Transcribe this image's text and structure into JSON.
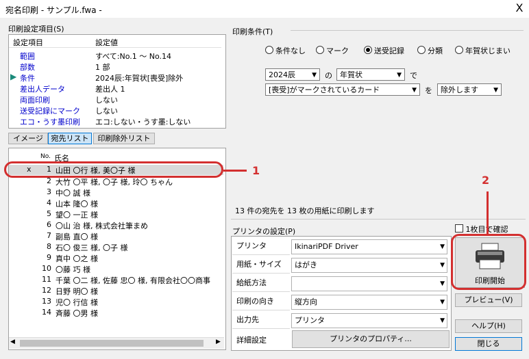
{
  "window": {
    "title": "宛名印刷 - サンプル.fwa -",
    "close": "X"
  },
  "left": {
    "section_label": "印刷設定項目(S)",
    "col_item": "設定項目",
    "col_value": "設定値",
    "rows": [
      {
        "item": "範囲",
        "value": "すべて:No.1 ～ No.14"
      },
      {
        "item": "部数",
        "value": "1 部"
      },
      {
        "item": "条件",
        "value": "2024辰:年賀状[喪受]除外"
      },
      {
        "item": "差出人データ",
        "value": "差出人 1"
      },
      {
        "item": "両面印刷",
        "value": "しない"
      },
      {
        "item": "送受記録にマーク",
        "value": "しない"
      },
      {
        "item": "エコ・うす墨印刷",
        "value": "エコ:しない・うす墨:しない"
      }
    ],
    "tabs": [
      "イメージ",
      "宛先リスト",
      "印刷除外リスト"
    ],
    "list_col_no": "No.",
    "list_col_name": "氏名",
    "list": [
      {
        "mark": "x",
        "no": "1",
        "name": "山田 〇行 様, 美〇子 様"
      },
      {
        "mark": "",
        "no": "2",
        "name": "大竹 〇平 様, 〇子 様, 玲〇 ちゃん"
      },
      {
        "mark": "",
        "no": "3",
        "name": "中〇 誠 様"
      },
      {
        "mark": "",
        "no": "4",
        "name": "山本 隆〇 様"
      },
      {
        "mark": "",
        "no": "5",
        "name": "望〇 一正 様"
      },
      {
        "mark": "",
        "no": "6",
        "name": "〇山 治 様, 株式会社筆まめ"
      },
      {
        "mark": "",
        "no": "7",
        "name": "副島 直〇 様"
      },
      {
        "mark": "",
        "no": "8",
        "name": "石〇 俊三 様, 〇子 様"
      },
      {
        "mark": "",
        "no": "9",
        "name": "真中 〇之 様"
      },
      {
        "mark": "",
        "no": "10",
        "name": "〇藤 巧 様"
      },
      {
        "mark": "",
        "no": "11",
        "name": "千葉 〇二 様, 佐藤 忠〇 様, 有限会社〇〇商事"
      },
      {
        "mark": "",
        "no": "12",
        "name": "日野 明〇 様"
      },
      {
        "mark": "",
        "no": "13",
        "name": "児〇 行信 様"
      },
      {
        "mark": "",
        "no": "14",
        "name": "斉藤 〇男 様"
      }
    ],
    "callout_1": "1"
  },
  "right": {
    "cond_label": "印刷条件(T)",
    "radios": [
      {
        "label": "条件なし",
        "on": false
      },
      {
        "label": "マーク",
        "on": false
      },
      {
        "label": "送受記録",
        "on": true
      },
      {
        "label": "分類",
        "on": false
      },
      {
        "label": "年賀状じまい",
        "on": false
      }
    ],
    "year": "2024辰",
    "no": "の",
    "kind": "年賀状",
    "de": "で",
    "mark_cond": "[喪受]がマークされているカード",
    "wo": "を",
    "action": "除外します",
    "summary": "13 件の宛先を 13 枚の用紙に印刷します",
    "printer_label": "プリンタの設定(P)",
    "grid": [
      {
        "key": "プリンタ",
        "value": "IkinariPDF Driver"
      },
      {
        "key": "用紙・サイズ",
        "value": "はがき"
      },
      {
        "key": "給紙方法",
        "value": ""
      },
      {
        "key": "印刷の向き",
        "value": "縦方向"
      },
      {
        "key": "出力先",
        "value": "プリンタ"
      }
    ],
    "detail_key": "詳細設定",
    "props_button": "プリンタのプロパティ...",
    "first_check": "1枚目で確認",
    "print_button": "印刷開始",
    "preview_button": "プレビュー(V)",
    "help_button": "ヘルプ(H)",
    "close_button": "閉じる",
    "callout_2": "2"
  },
  "colors": {
    "annotation": "#d32f2f",
    "selection": "#cce4f7",
    "link": "#0000cc"
  }
}
